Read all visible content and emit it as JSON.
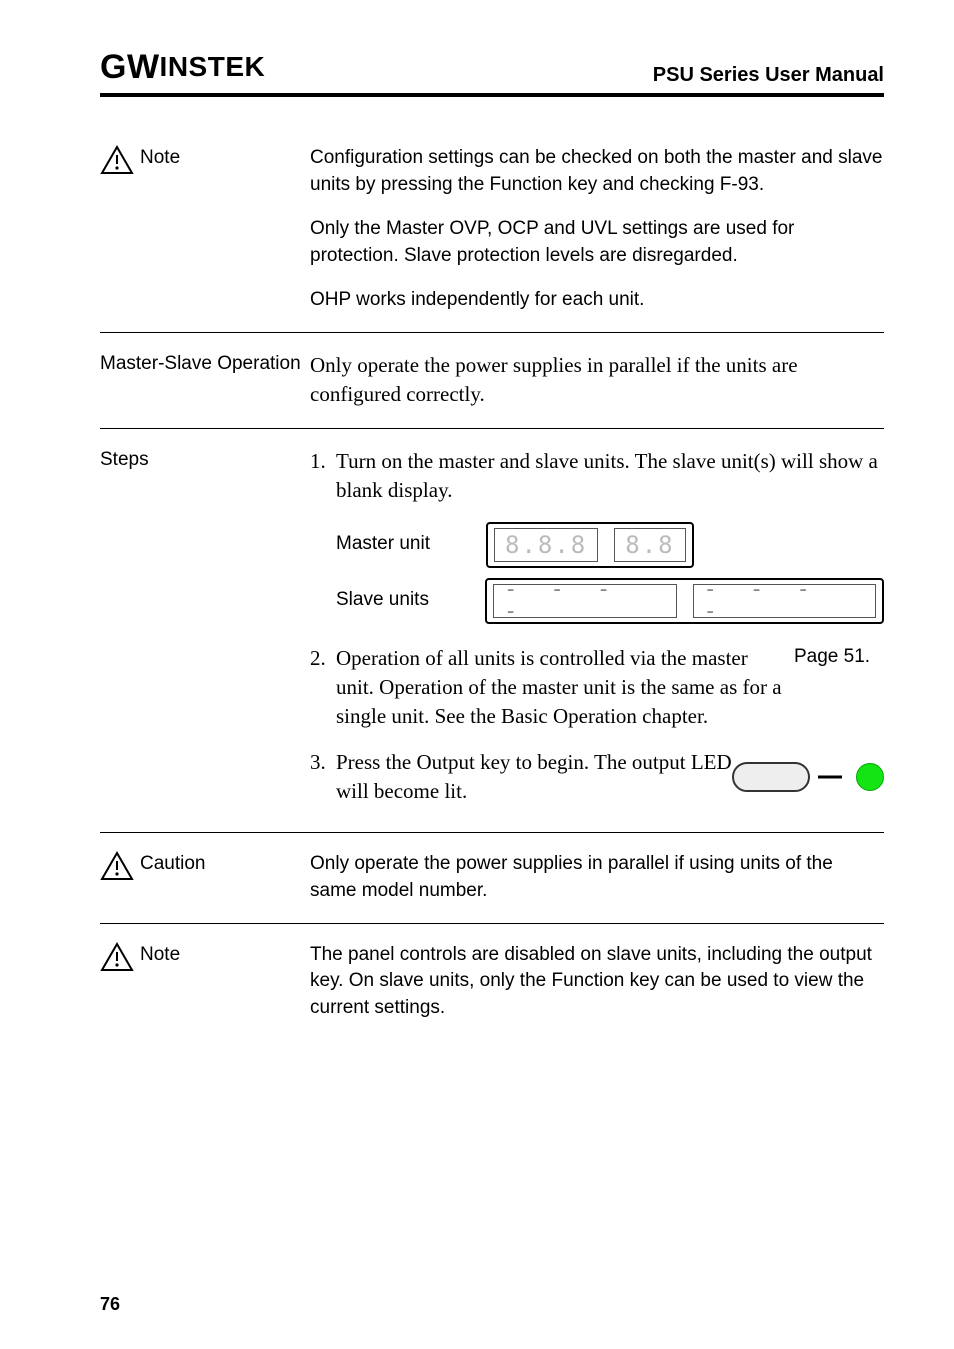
{
  "header": {
    "logo_gw": "GW",
    "logo_rest": "INSTEK",
    "manual_title": "PSU Series User Manual"
  },
  "note1": {
    "label": "Note",
    "p1": "Configuration settings can be checked on both the master and slave units by pressing the Function key and checking F-93.",
    "p2": "Only the Master OVP, OCP and UVL settings are used for protection. Slave protection levels are disregarded.",
    "p3": "OHP works independently for each unit."
  },
  "master_slave": {
    "label": "Master-Slave Operation",
    "text": "Only operate the power supplies in parallel if the units are configured correctly."
  },
  "steps": {
    "label": "Steps",
    "s1_num": "1.",
    "s1_text": "Turn on the master and slave units. The slave unit(s) will show a blank display.",
    "master_unit_label": "Master unit",
    "master_seg_left": "8.8.8",
    "master_seg_right": "8.8",
    "slave_units_label": "Slave units",
    "slave_dash_left": "- - - -",
    "slave_dash_right": "- - - -",
    "s2_num": "2.",
    "s2_text": "Operation of all units is controlled via the master unit. Operation of the master unit is the same as for a single unit. See the Basic Operation chapter.",
    "s2_ref": "Page 51.",
    "s3_num": "3.",
    "s3_text": "Press the Output key to begin. The output LED will become lit."
  },
  "caution": {
    "label": "Caution",
    "text": "Only operate the power supplies in parallel if using units of the same model number."
  },
  "note2": {
    "label": "Note",
    "text": "The panel controls are disabled on slave units, including the output key. On slave units, only the Function key can be used to view the current settings."
  },
  "page_number": "76"
}
